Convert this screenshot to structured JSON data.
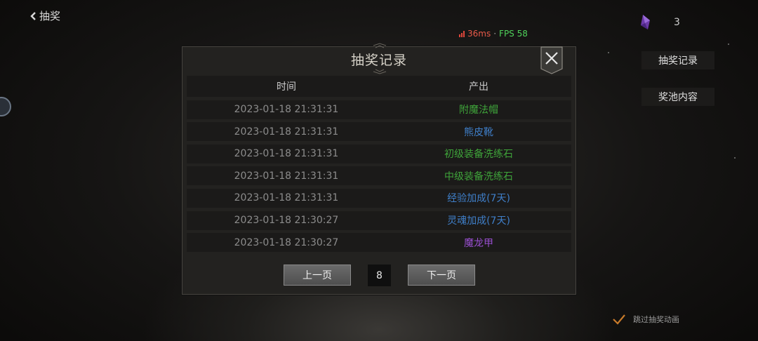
{
  "header": {
    "back_label": "抽奖"
  },
  "status": {
    "latency": "36ms",
    "separator": "·",
    "fps": "FPS 58"
  },
  "currency": {
    "icon": "purple-crystal-icon",
    "count": "3"
  },
  "side_menu": {
    "records_label": "抽奖记录",
    "pool_label": "奖池内容"
  },
  "skip_animation": {
    "label": "跳过抽奖动画",
    "checked": true
  },
  "dialog": {
    "title": "抽奖记录",
    "columns": {
      "time": "时间",
      "output": "产出"
    },
    "rows": [
      {
        "time": "2023-01-18 21:31:31",
        "item": "附魔法帽",
        "color": "#3fa43a"
      },
      {
        "time": "2023-01-18 21:31:31",
        "item": "熊皮靴",
        "color": "#3f7fc9"
      },
      {
        "time": "2023-01-18 21:31:31",
        "item": "初级装备洗练石",
        "color": "#3fa43a"
      },
      {
        "time": "2023-01-18 21:31:31",
        "item": "中级装备洗练石",
        "color": "#3fa43a"
      },
      {
        "time": "2023-01-18 21:31:31",
        "item": "经验加成(7天)",
        "color": "#3f7fc9"
      },
      {
        "time": "2023-01-18 21:30:27",
        "item": "灵魂加成(7天)",
        "color": "#3f7fc9"
      },
      {
        "time": "2023-01-18 21:30:27",
        "item": "魔龙甲",
        "color": "#9a4fd1"
      }
    ],
    "pager": {
      "prev_label": "上一页",
      "page": "8",
      "next_label": "下一页"
    }
  },
  "colors": {
    "quality_green": "#3fa43a",
    "quality_blue": "#3f7fc9",
    "quality_purple": "#9a4fd1",
    "fps_green": "#4fd25a",
    "latency_red": "#e85a4a"
  }
}
